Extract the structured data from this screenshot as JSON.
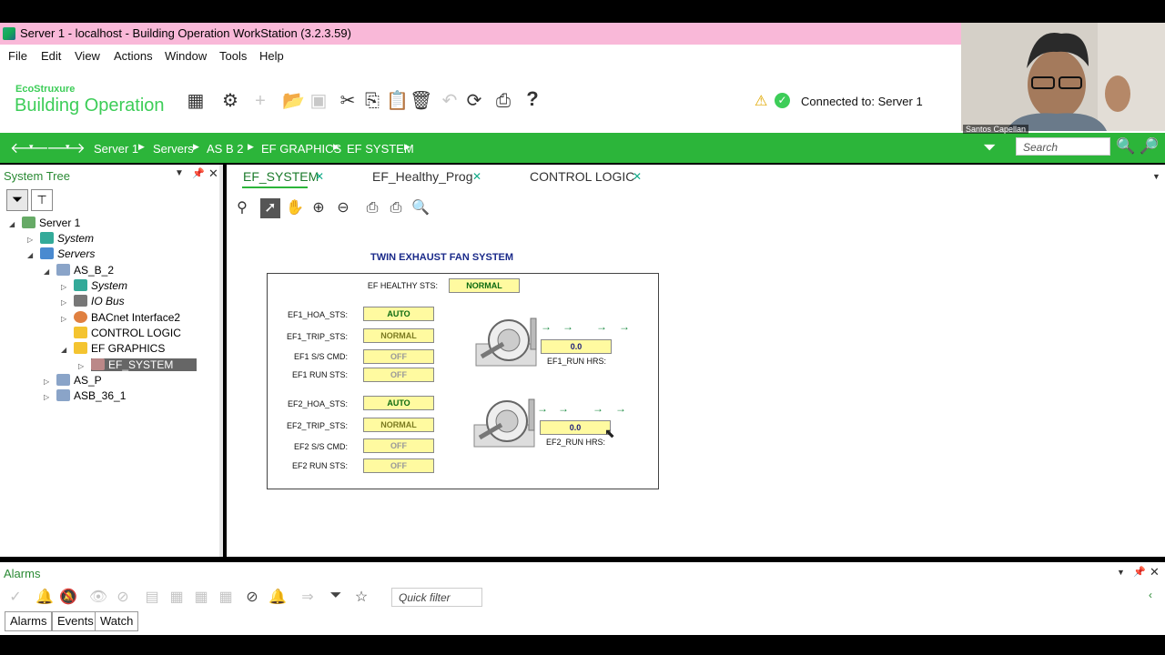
{
  "window": {
    "title": "Server 1 - localhost - Building Operation WorkStation (3.2.3.59)"
  },
  "menu": [
    "File",
    "Edit",
    "View",
    "Actions",
    "Window",
    "Tools",
    "Help"
  ],
  "brand": {
    "eco": "EcoStruxure",
    "product": "Building Operation"
  },
  "status": {
    "connected_label": "Connected to:",
    "server": "Server 1"
  },
  "breadcrumb": [
    "Server 1",
    "Servers",
    "AS B 2",
    "EF GRAPHICS",
    "EF SYSTEM"
  ],
  "search": {
    "placeholder": "Search"
  },
  "system_tree": {
    "title": "System Tree",
    "items": [
      {
        "label": "Server 1",
        "icon": "server-icon"
      },
      {
        "label": "System",
        "icon": "system-icon"
      },
      {
        "label": "Servers",
        "icon": "servers-icon"
      },
      {
        "label": "AS_B_2",
        "icon": "automation-server-icon"
      },
      {
        "label": "System",
        "icon": "system-icon"
      },
      {
        "label": "IO Bus",
        "icon": "io-bus-icon"
      },
      {
        "label": "BACnet Interface2",
        "icon": "bacnet-icon"
      },
      {
        "label": "CONTROL LOGIC",
        "icon": "folder-icon"
      },
      {
        "label": "EF GRAPHICS",
        "icon": "folder-icon"
      },
      {
        "label": "EF_SYSTEM",
        "icon": "graphic-icon"
      },
      {
        "label": "AS_P",
        "icon": "automation-server-icon"
      },
      {
        "label": "ASB_36_1",
        "icon": "automation-server-icon"
      }
    ]
  },
  "tabs": [
    {
      "label": "EF_SYSTEM"
    },
    {
      "label": "EF_Healthy_Prog"
    },
    {
      "label": "CONTROL LOGIC"
    }
  ],
  "graphic": {
    "title": "TWIN EXHAUST FAN SYSTEM",
    "healthy_label": "EF HEALTHY STS:",
    "healthy_value": "NORMAL",
    "ef1": {
      "hoa_label": "EF1_HOA_STS:",
      "hoa_value": "AUTO",
      "trip_label": "EF1_TRIP_STS:",
      "trip_value": "NORMAL",
      "cmd_label": "EF1 S/S CMD:",
      "cmd_value": "OFF",
      "run_label": "EF1 RUN STS:",
      "run_value": "OFF",
      "hrs_value": "0.0",
      "hrs_label": "EF1_RUN HRS:"
    },
    "ef2": {
      "hoa_label": "EF2_HOA_STS:",
      "hoa_value": "AUTO",
      "trip_label": "EF2_TRIP_STS:",
      "trip_value": "NORMAL",
      "cmd_label": "EF2 S/S CMD:",
      "cmd_value": "OFF",
      "run_label": "EF2 RUN STS:",
      "run_value": "OFF",
      "hrs_value": "0.0",
      "hrs_label": "EF2_RUN HRS:"
    }
  },
  "alarms": {
    "title": "Alarms",
    "quick_filter_placeholder": "Quick filter",
    "tabs": [
      "Alarms",
      "Events",
      "Watch"
    ]
  },
  "webcam": {
    "name": "Santos Capellan"
  },
  "colors": {
    "accent_green": "#2cb53a",
    "title_bar": "#f9b8d8",
    "value_box": "#fffaa0"
  }
}
